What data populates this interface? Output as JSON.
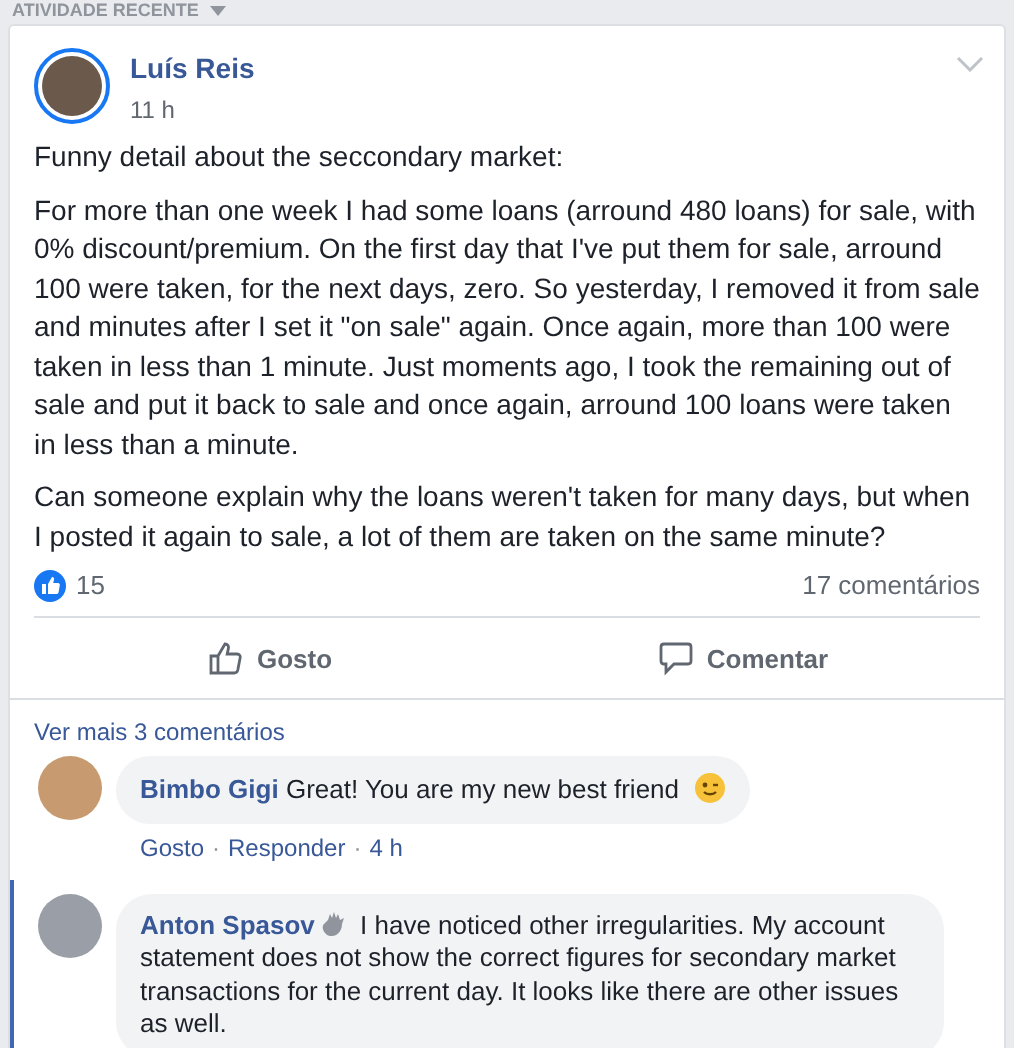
{
  "section_title": "ATIVIDADE RECENTE",
  "post": {
    "author": "Luís Reis",
    "time": "11 h",
    "paragraphs": [
      "Funny detail about the seccondary market:",
      "For more than one week I had some loans (arround 480 loans) for sale, with 0% discount/premium. On the first day that I've put them for sale, arround 100 were taken, for the next days, zero. So yesterday, I removed it from sale and minutes after I set it \"on sale\" again. Once again, more than 100 were taken in less than 1 minute. Just moments ago, I took the remaining out of sale and put it back to sale and once again, arround 100 loans were taken in less than a minute.",
      "Can someone explain why the loans weren't taken for many days, but when I posted it again to sale, a lot of them are taken on the same minute?"
    ],
    "likes": "15",
    "comments_count": "17 comentários",
    "actions": [
      {
        "kind": "like",
        "label": "Gosto"
      },
      {
        "kind": "comment",
        "label": "Comentar"
      }
    ]
  },
  "view_more": "Ver mais 3 comentários",
  "comments": [
    {
      "author": "Bimbo Gigi",
      "text": "Great! You are my new best friend",
      "emoji": true,
      "badge": false,
      "highlighted": false,
      "meta": [
        "Gosto",
        "Responder",
        "4 h"
      ],
      "separator": "·"
    },
    {
      "author": "Anton Spasov",
      "text": "I have noticed other irregularities. My account statement does not show the correct figures for secondary market transactions for the current day. It looks like there are other issues as well.",
      "emoji": false,
      "badge": true,
      "highlighted": true
    }
  ]
}
